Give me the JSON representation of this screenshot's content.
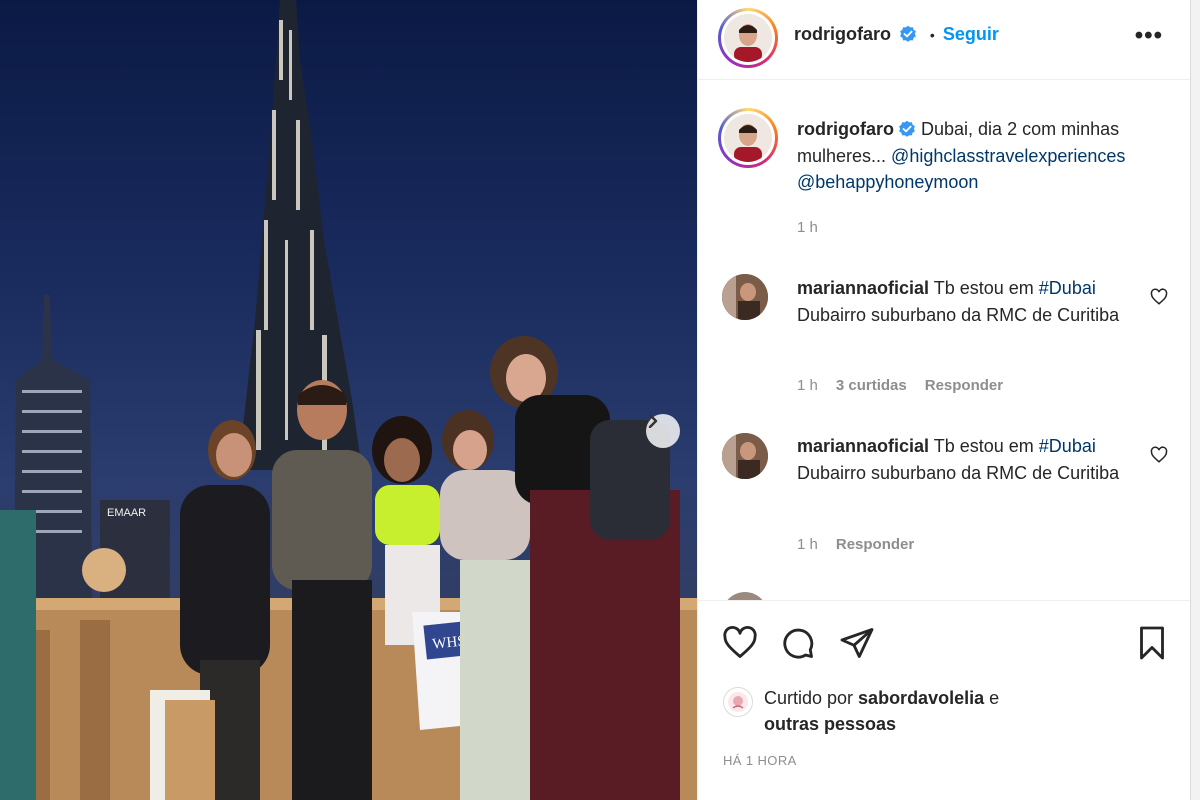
{
  "post": {
    "author": "rodrigofaro",
    "follow_label": "Seguir",
    "more_label": "•••",
    "dot": "•",
    "image_texts": {
      "building_sign": "EMAAR",
      "bag_brand": "WHSmith"
    }
  },
  "caption": {
    "username": "rodrigofaro",
    "text_before": "Dubai, dia 2 com minhas mulheres... ",
    "mention_1": "@highclasstravelexperiences",
    "mention_2": "@behappyhoneymoon",
    "time": "1 h"
  },
  "comments": [
    {
      "username": "mariannaoficial",
      "text_start": "Tb estou em",
      "hashtag": "#Dubai",
      "text_end": " Dubairro suburbano da RMC de Curitiba",
      "time": "1 h",
      "likes": "3 curtidas",
      "reply": "Responder"
    },
    {
      "username": "mariannaoficial",
      "text_start": "Tb estou em",
      "hashtag": "#Dubai",
      "text_end": " Dubairro suburbano da RMC de Curitiba",
      "time": "1 h",
      "reply": "Responder"
    }
  ],
  "likes": {
    "prefix": "Curtido por ",
    "user": "sabordavolelia",
    "suffix": " e",
    "others": "outras pessoas"
  },
  "timestamp": "HÁ 1 HORA",
  "colors": {
    "link_blue": "#0095f6",
    "mention_blue": "#00376b",
    "muted": "#8e8e8e",
    "text": "#262626"
  },
  "icons": [
    "verified-badge-icon",
    "more-options-icon",
    "heart-icon",
    "comment-icon",
    "share-icon",
    "bookmark-icon",
    "next-arrow-icon"
  ]
}
